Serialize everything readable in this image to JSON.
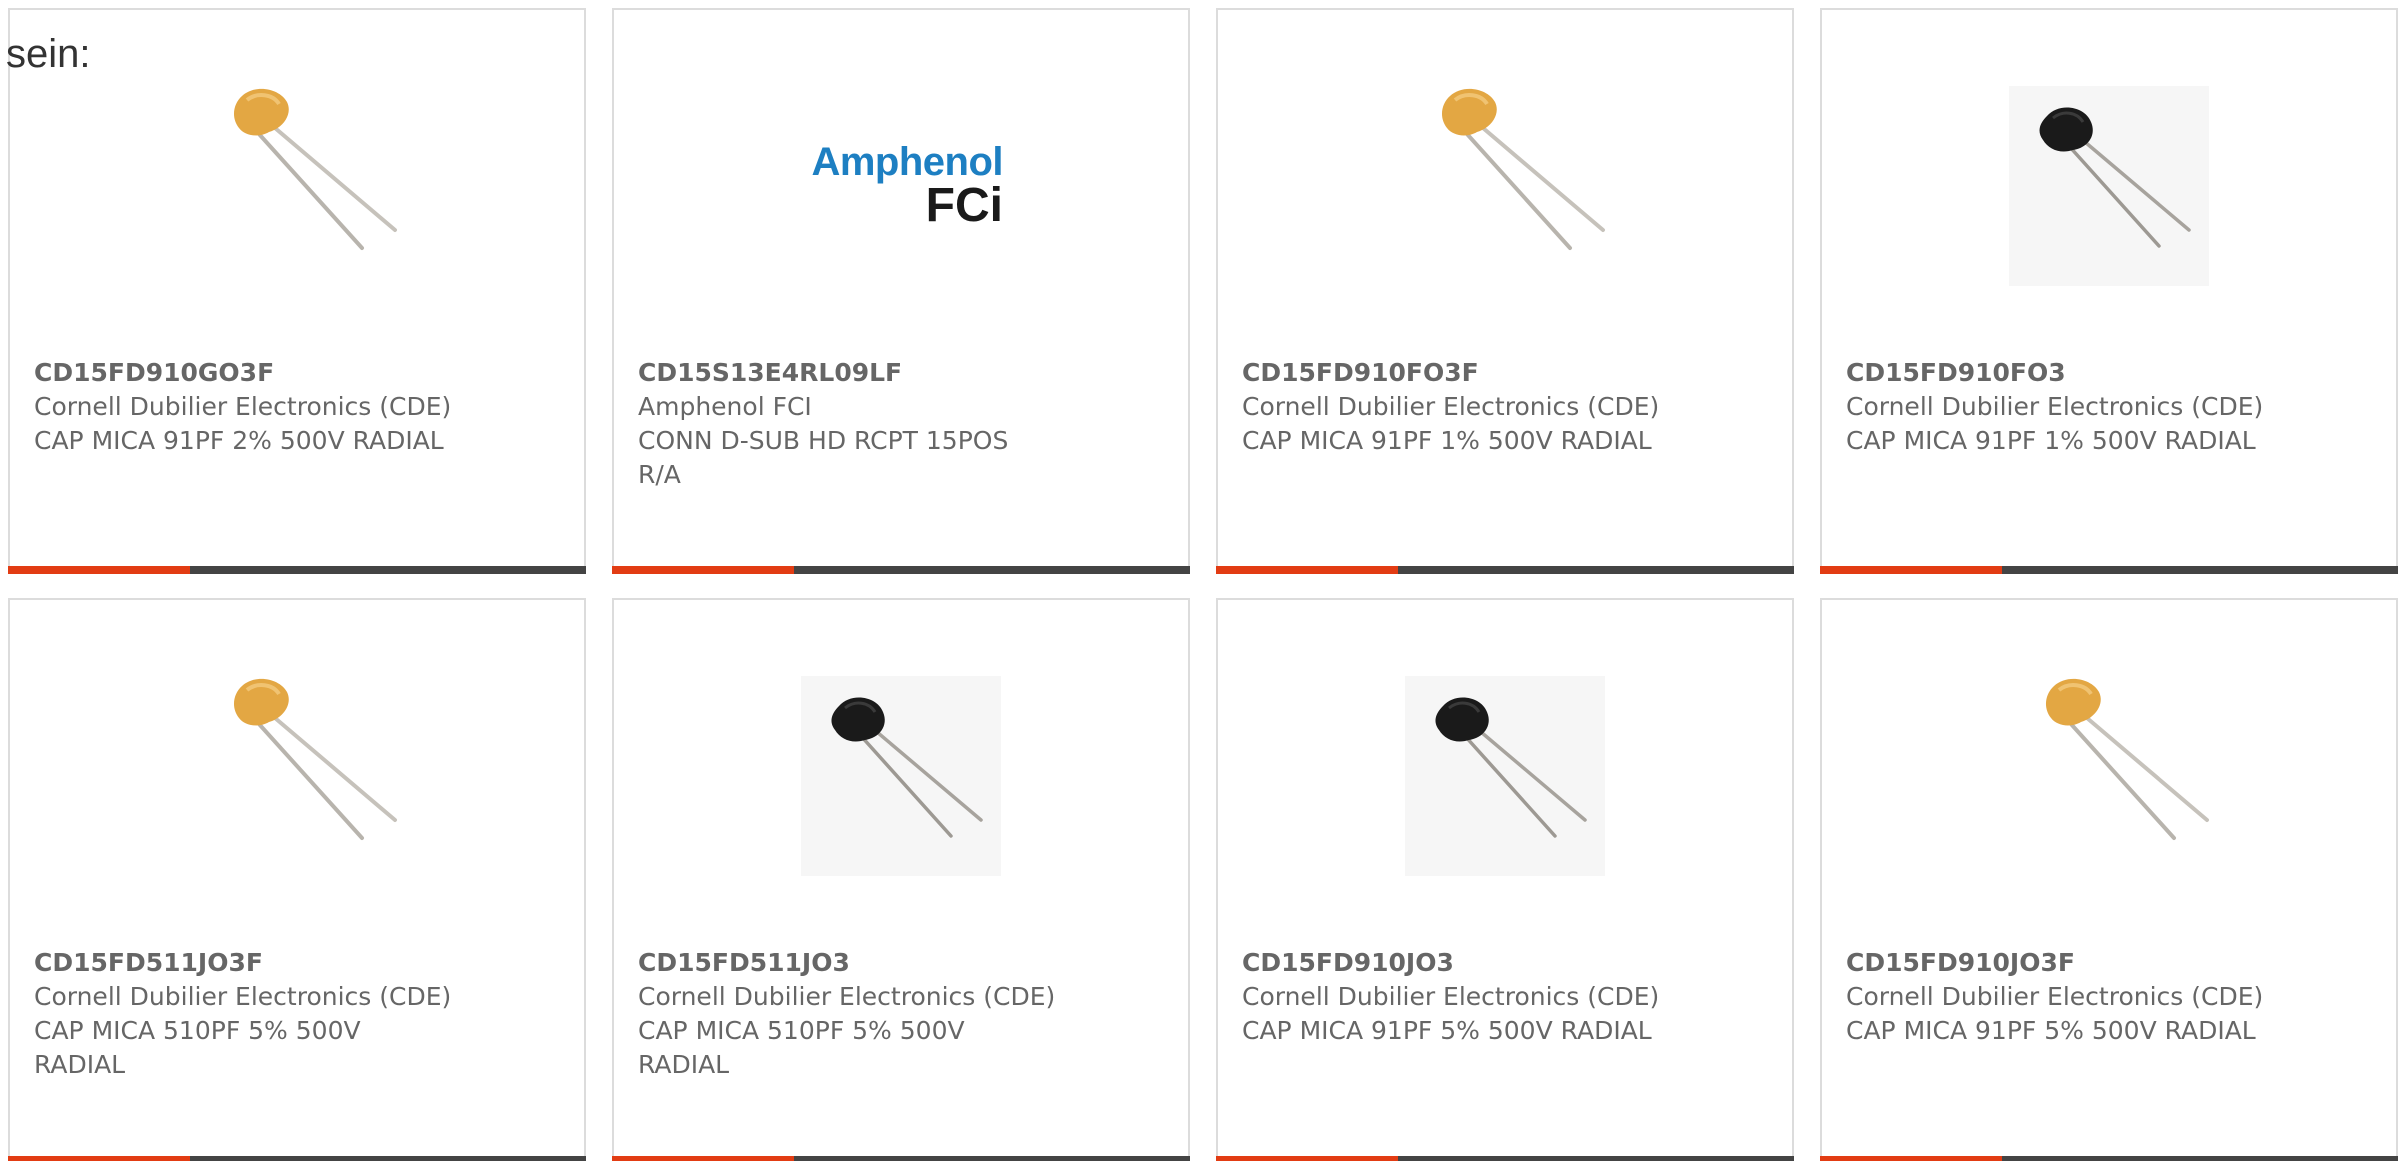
{
  "page": {
    "heading_fragment": "sein:"
  },
  "colors": {
    "accent": "#e23c13",
    "bar": "#444444",
    "card_border": "#dcdcdc",
    "text": "#666666",
    "mica_orange": "#e3a743",
    "mica_black": "#1a1a1a",
    "amphenol_blue": "#1d7fc2"
  },
  "products": [
    {
      "part_number": "CD15FD910GO3F",
      "manufacturer": "Cornell Dubilier Electronics (CDE)",
      "description": "CAP MICA 91PF 2% 500V RADIAL",
      "image_type": "mica-capacitor-orange"
    },
    {
      "part_number": "CD15S13E4RL09LF",
      "manufacturer": "Amphenol FCI",
      "description": "CONN D-SUB HD RCPT 15POS R/A",
      "image_type": "amphenol-fci-logo",
      "logo_text_top": "Amphenol",
      "logo_text_bottom": "FCi"
    },
    {
      "part_number": "CD15FD910FO3F",
      "manufacturer": "Cornell Dubilier Electronics (CDE)",
      "description": "CAP MICA 91PF 1% 500V RADIAL",
      "image_type": "mica-capacitor-orange"
    },
    {
      "part_number": "CD15FD910FO3",
      "manufacturer": "Cornell Dubilier Electronics (CDE)",
      "description": "CAP MICA 91PF 1% 500V RADIAL",
      "image_type": "mica-capacitor-black"
    },
    {
      "part_number": "CD15FD511JO3F",
      "manufacturer": "Cornell Dubilier Electronics (CDE)",
      "description": "CAP MICA 510PF 5% 500V RADIAL",
      "image_type": "mica-capacitor-orange"
    },
    {
      "part_number": "CD15FD511JO3",
      "manufacturer": "Cornell Dubilier Electronics (CDE)",
      "description": "CAP MICA 510PF 5% 500V RADIAL",
      "image_type": "mica-capacitor-black"
    },
    {
      "part_number": "CD15FD910JO3",
      "manufacturer": "Cornell Dubilier Electronics (CDE)",
      "description": "CAP MICA 91PF 5% 500V RADIAL",
      "image_type": "mica-capacitor-black"
    },
    {
      "part_number": "CD15FD910JO3F",
      "manufacturer": "Cornell Dubilier Electronics (CDE)",
      "description": "CAP MICA 91PF 5% 500V RADIAL",
      "image_type": "mica-capacitor-orange"
    }
  ]
}
